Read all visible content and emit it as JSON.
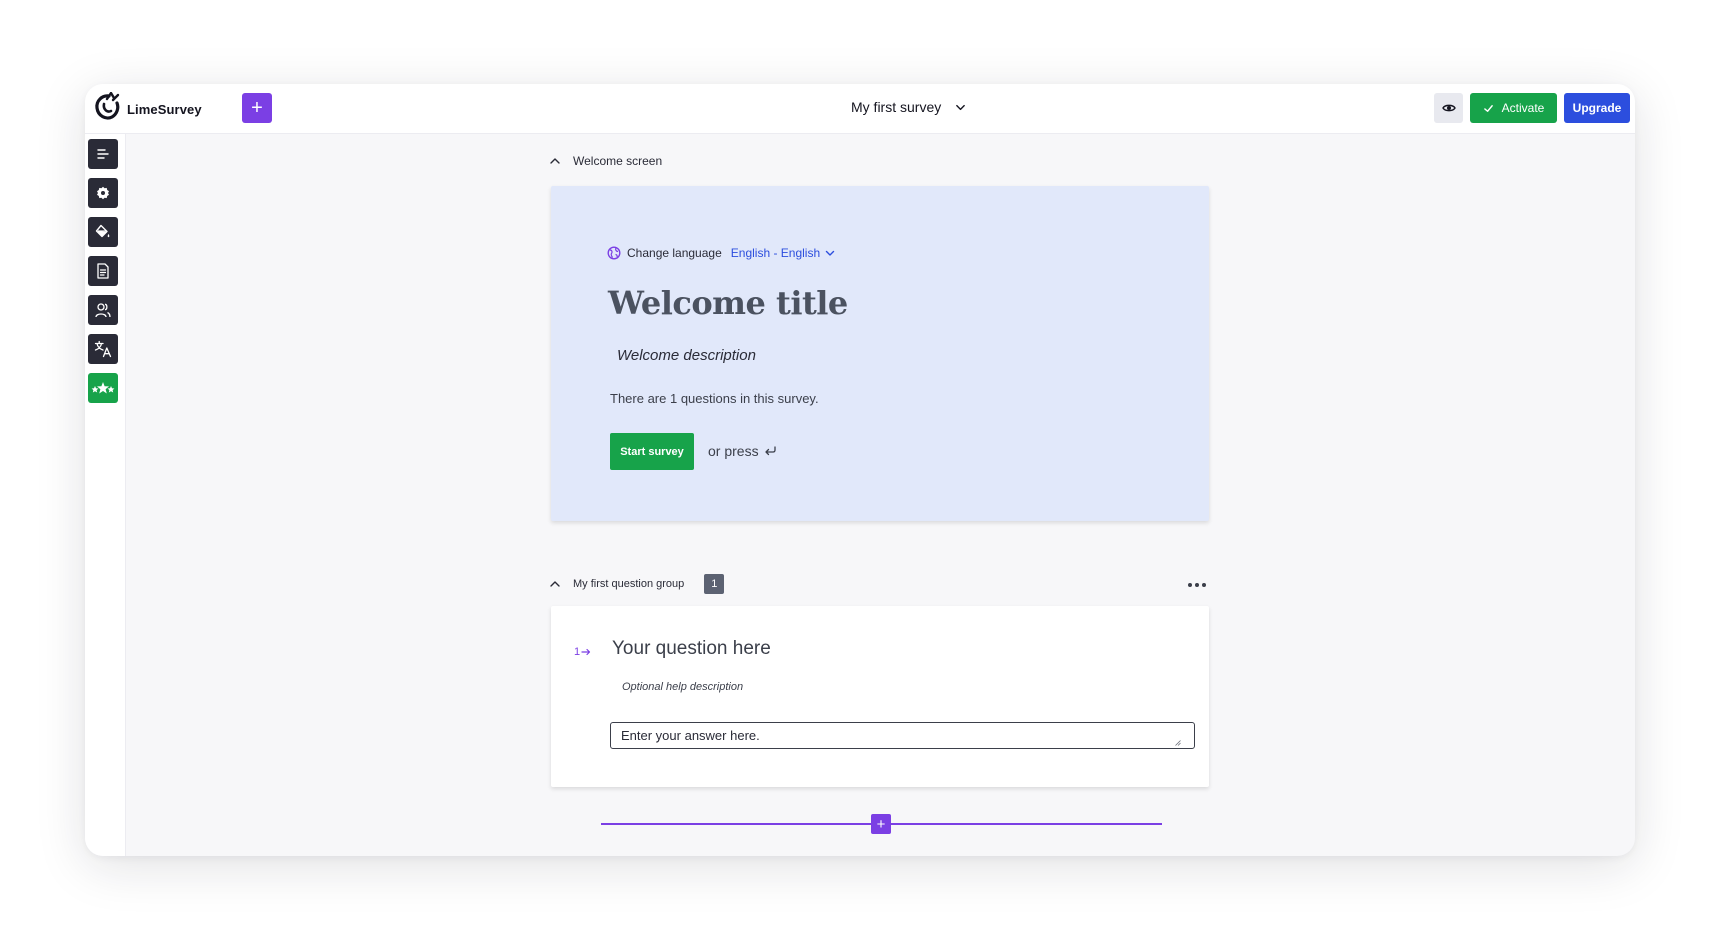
{
  "app": {
    "logo_text": "LimeSurvey"
  },
  "header": {
    "add_label": "+",
    "survey_title": "My first survey",
    "activate_label": "Activate",
    "upgrade_label": "Upgrade"
  },
  "sidebar": {
    "items": [
      {
        "name": "structure",
        "icon": "list-icon"
      },
      {
        "name": "settings",
        "icon": "gear-icon"
      },
      {
        "name": "theme",
        "icon": "paint-bucket-icon"
      },
      {
        "name": "document",
        "icon": "document-icon"
      },
      {
        "name": "participants",
        "icon": "users-icon"
      },
      {
        "name": "translate",
        "icon": "translate-icon"
      },
      {
        "name": "rating",
        "icon": "stars-icon"
      }
    ]
  },
  "welcome_section": {
    "header_label": "Welcome screen",
    "change_language_label": "Change language",
    "language_value": "English - English",
    "title": "Welcome title",
    "description": "Welcome description",
    "questions_count_text": "There are 1 questions in this survey.",
    "start_button_label": "Start survey",
    "or_press_label": "or press"
  },
  "question_group": {
    "header_label": "My first question group",
    "badge_count": "1",
    "question": {
      "number": "1",
      "text": "Your question here",
      "help": "Optional help description",
      "answer_placeholder": "Enter your answer here."
    }
  },
  "add_button_label": "+",
  "colors": {
    "accent_purple": "#7b3fe4",
    "activate_green": "#17a34a",
    "upgrade_blue": "#2c4ede",
    "welcome_bg": "#e1e8fa",
    "sidebar_btn": "#2a2b37"
  }
}
